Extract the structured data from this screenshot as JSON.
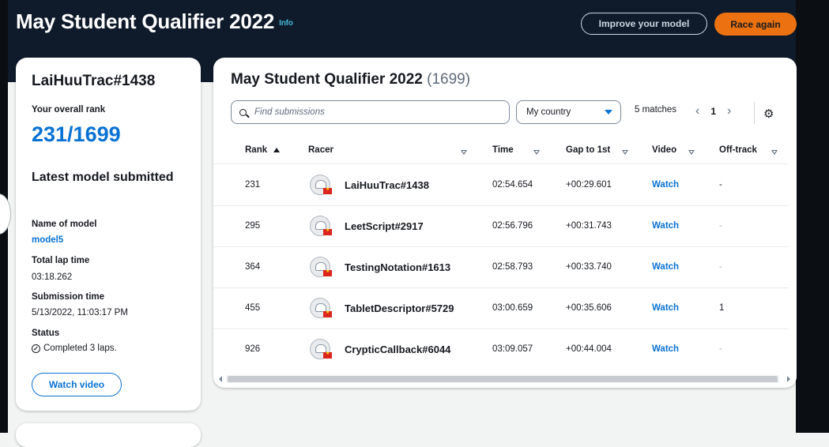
{
  "header": {
    "title": "May Student Qualifier 2022",
    "info_link": "Info",
    "improve_button": "Improve your model",
    "race_button": "Race again"
  },
  "profile": {
    "racer_name": "LaiHuuTrac#1438",
    "overall_rank_label": "Your overall rank",
    "overall_rank": "231/1699",
    "latest_title": "Latest model submitted",
    "model_name_label": "Name of model",
    "model_name": "model5",
    "lap_time_label": "Total lap time",
    "lap_time": "03:18.262",
    "submission_label": "Submission time",
    "submission_time": "5/13/2022, 11:03:17 PM",
    "status_label": "Status",
    "status": "Completed 3 laps.",
    "watch_button": "Watch video"
  },
  "leaderboard": {
    "title": "May Student Qualifier 2022",
    "count": "(1699)",
    "search_placeholder": "Find submissions",
    "filter_value": "My country",
    "matches": "5 matches",
    "page": "1",
    "columns": [
      "Rank",
      "Racer",
      "Time",
      "Gap to 1st",
      "Video",
      "Off-track"
    ],
    "rows": [
      {
        "rank": "231",
        "racer": "LaiHuuTrac#1438",
        "time": "02:54.654",
        "gap": "+00:29.601",
        "video": "Watch",
        "offtrack": "-"
      },
      {
        "rank": "295",
        "racer": "LeetScript#2917",
        "time": "02:56.796",
        "gap": "+00:31.743",
        "video": "Watch",
        "offtrack": "-"
      },
      {
        "rank": "364",
        "racer": "TestingNotation#1613",
        "time": "02:58.793",
        "gap": "+00:33.740",
        "video": "Watch",
        "offtrack": "-"
      },
      {
        "rank": "455",
        "racer": "TabletDescriptor#5729",
        "time": "03:00.659",
        "gap": "+00:35.606",
        "video": "Watch",
        "offtrack": "1"
      },
      {
        "rank": "926",
        "racer": "CrypticCallback#6044",
        "time": "03:09.057",
        "gap": "+00:44.004",
        "video": "Watch",
        "offtrack": "-"
      }
    ]
  },
  "icons": {
    "search": "search-icon",
    "dropdown": "caret-down-icon",
    "settings": "gear-icon",
    "status": "check-circle-icon",
    "flag": "vietnam-flag-icon",
    "avatar": "racer-avatar-icon"
  },
  "colors": {
    "header_bg": "#0f1b2a",
    "accent": "#ec7211",
    "link": "#0972d3"
  }
}
